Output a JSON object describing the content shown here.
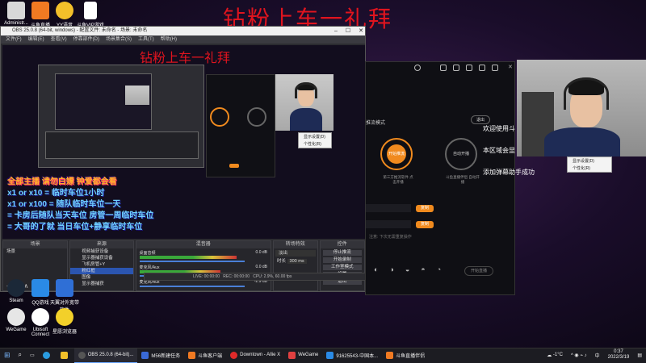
{
  "overlay_title": "钻粉上车一礼拜",
  "desktop_icons": [
    {
      "label": "Administr...",
      "color": "#d8d8d8"
    },
    {
      "label": "斗鱼直播",
      "color": "#f07a22"
    },
    {
      "label": "YY语音",
      "color": "#f2c02a"
    },
    {
      "label": "斗鱼VIP游戏",
      "color": "#ffffff"
    },
    {
      "label": "Steam",
      "color": "#1b2838"
    },
    {
      "label": "QQ游戏",
      "color": "#2a8ae6"
    },
    {
      "label": "天翼对外宽带软件",
      "color": "#2f6fd6"
    },
    {
      "label": "WeGame",
      "color": "#e6e6e6"
    },
    {
      "label": "Ubisoft Connect",
      "color": "#ffffff"
    },
    {
      "label": "星愿浏览器",
      "color": "#f2d02a"
    }
  ],
  "obs": {
    "title": "OBS 25.0.8 (64-bit, windows) - 配置文件: 未命名 - 场景: 未命名",
    "menu": [
      "文件(F)",
      "编辑(E)",
      "查看(V)",
      "停靠部件(D)",
      "场景集合(S)",
      "工具(T)",
      "帮助(H)"
    ],
    "overlay_lines": [
      "全部主播  请勿白嫖  钟爱都会看",
      "x1 or  x10 = 临时车位1小时",
      "x1 or  x100 = 随队临时车位一天",
      "= 卡房后随队当天车位 房管一周临时车位",
      "= 大哥的了就 当日车位+静享临时车位"
    ],
    "docks": {
      "scenes": {
        "title": "场景",
        "items": [
          "场景"
        ]
      },
      "sources": {
        "title": "来源",
        "items": [
          "视频捕获设备",
          "显示器捕获设备",
          "飞机房管+Y",
          "粉红框",
          "图像",
          "显示器捕获"
        ],
        "selected": 3
      },
      "mixer": {
        "title": "混音器",
        "tracks": [
          {
            "label": "桌面音频",
            "db": "0.0 dB"
          },
          {
            "label": "麦克风/Aux",
            "db": "0.0 dB"
          },
          {
            "label": "麦克风/Aux",
            "db": "-2.9 dB"
          }
        ]
      },
      "transitions": {
        "title": "转场特效",
        "type": "淡出",
        "duration_label": "时长",
        "duration": "300 ms"
      },
      "controls": {
        "title": "控件",
        "buttons": [
          "停止推流",
          "开始录制",
          "工作室模式",
          "设置",
          "退出"
        ]
      }
    },
    "status": {
      "live": "LIVE: 00:00:00",
      "rec": "REC: 00:00:00",
      "cpu": "CPU: 2.9%, 60.00 fps"
    }
  },
  "assistant": {
    "circle_left": "开始推流",
    "circle_right": "自动开播",
    "mode_label": "推流模式",
    "exit_label": "退出",
    "desc_left": "第三方推流软件 点击开播",
    "desc_right": "斗鱼直播伴侣 自动开播",
    "copy1": "复制",
    "copy2": "复制",
    "footer": "注意: 下次无需重复操作",
    "start_button": "开始直播"
  },
  "side_texts": [
    "欢迎使用斗",
    "本区域会显",
    "添加弹幕助手成功"
  ],
  "mini_ctx_menu": [
    "显示设置(D)",
    "个性化(R)"
  ],
  "taskbar": {
    "search_icon": "search-icon",
    "items": [
      {
        "label": "OBS 25.0.8 (64-bit)...",
        "color": "#555555",
        "active": true
      },
      {
        "label": "M56新建任务",
        "color": "#3a6ad6",
        "active": false
      },
      {
        "label": "斗鱼客户端",
        "color": "#f07a22",
        "active": false
      },
      {
        "label": "Downtown - Allie X",
        "color": "#e02a2a",
        "active": false
      },
      {
        "label": "WeGame",
        "color": "#e04040",
        "active": false
      },
      {
        "label": "91625543-中国本...",
        "color": "#2a8ae6",
        "active": false
      },
      {
        "label": "斗鱼直播伴侣",
        "color": "#f07a22",
        "active": false
      }
    ],
    "temperature": "-1°C",
    "ime": "中",
    "time": "0:37",
    "date": "2022/3/19"
  }
}
